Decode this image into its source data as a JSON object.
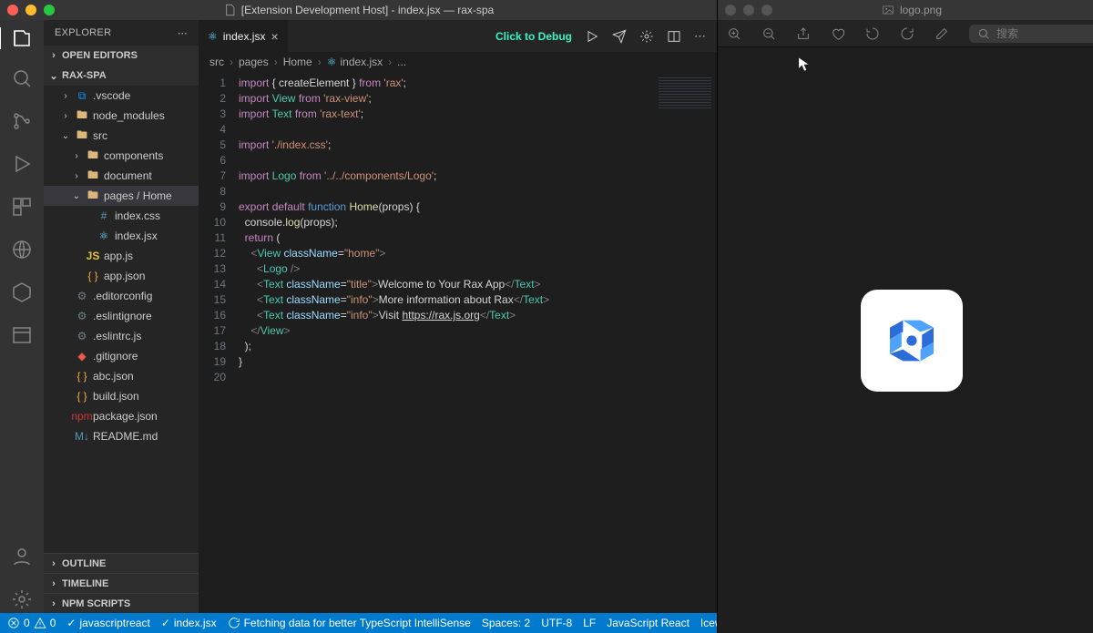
{
  "window": {
    "title": "[Extension Development Host] - index.jsx — rax-spa",
    "right_title": "logo.png"
  },
  "sidebar": {
    "header": "EXPLORER",
    "sections": {
      "open_editors": "OPEN EDITORS",
      "project": "RAX-SPA",
      "outline": "OUTLINE",
      "timeline": "TIMELINE",
      "npm_scripts": "NPM SCRIPTS"
    },
    "tree": [
      {
        "name": ".vscode",
        "type": "folder-vscode",
        "depth": 1,
        "closed": true
      },
      {
        "name": "node_modules",
        "type": "folder",
        "depth": 1,
        "closed": true
      },
      {
        "name": "src",
        "type": "folder",
        "depth": 1,
        "open": true
      },
      {
        "name": "components",
        "type": "folder",
        "depth": 2,
        "closed": true
      },
      {
        "name": "document",
        "type": "folder",
        "depth": 2,
        "closed": true
      },
      {
        "name": "pages / Home",
        "type": "folder",
        "depth": 2,
        "open": true,
        "selected": true
      },
      {
        "name": "index.css",
        "type": "css",
        "depth": 3
      },
      {
        "name": "index.jsx",
        "type": "react",
        "depth": 3
      },
      {
        "name": "app.js",
        "type": "js",
        "depth": 2
      },
      {
        "name": "app.json",
        "type": "json",
        "depth": 2
      },
      {
        "name": ".editorconfig",
        "type": "cfg",
        "depth": 1
      },
      {
        "name": ".eslintignore",
        "type": "cfg",
        "depth": 1
      },
      {
        "name": ".eslintrc.js",
        "type": "cfg",
        "depth": 1
      },
      {
        "name": ".gitignore",
        "type": "git",
        "depth": 1
      },
      {
        "name": "abc.json",
        "type": "json",
        "depth": 1
      },
      {
        "name": "build.json",
        "type": "json",
        "depth": 1
      },
      {
        "name": "package.json",
        "type": "npm",
        "depth": 1
      },
      {
        "name": "README.md",
        "type": "md",
        "depth": 1
      }
    ]
  },
  "tabs": {
    "active": "index.jsx",
    "debug_hint": "Click to Debug"
  },
  "breadcrumbs": [
    "src",
    "pages",
    "Home",
    "index.jsx",
    "..."
  ],
  "code": {
    "lines": [
      [
        {
          "t": "import",
          "c": "red"
        },
        {
          "t": " { createElement } ",
          "c": "white"
        },
        {
          "t": "from",
          "c": "red"
        },
        {
          "t": " 'rax'",
          "c": "string"
        },
        {
          "t": ";",
          "c": "white"
        }
      ],
      [
        {
          "t": "import",
          "c": "red"
        },
        {
          "t": " View ",
          "c": "type"
        },
        {
          "t": "from",
          "c": "red"
        },
        {
          "t": " 'rax-view'",
          "c": "string"
        },
        {
          "t": ";",
          "c": "white"
        }
      ],
      [
        {
          "t": "import",
          "c": "red"
        },
        {
          "t": " Text ",
          "c": "type"
        },
        {
          "t": "from",
          "c": "red"
        },
        {
          "t": " 'rax-text'",
          "c": "string"
        },
        {
          "t": ";",
          "c": "white"
        }
      ],
      [],
      [
        {
          "t": "import",
          "c": "red"
        },
        {
          "t": " './index.css'",
          "c": "string"
        },
        {
          "t": ";",
          "c": "white"
        }
      ],
      [],
      [
        {
          "t": "import",
          "c": "red"
        },
        {
          "t": " Logo ",
          "c": "type"
        },
        {
          "t": "from",
          "c": "red"
        },
        {
          "t": " '../../components/Logo'",
          "c": "string"
        },
        {
          "t": ";",
          "c": "white"
        }
      ],
      [],
      [
        {
          "t": "export",
          "c": "red"
        },
        {
          "t": " ",
          "c": "white"
        },
        {
          "t": "default",
          "c": "red"
        },
        {
          "t": " ",
          "c": "white"
        },
        {
          "t": "function",
          "c": "blue"
        },
        {
          "t": " ",
          "c": "white"
        },
        {
          "t": "Home",
          "c": "yellow"
        },
        {
          "t": "(props) {",
          "c": "white"
        }
      ],
      [
        {
          "t": "  console.",
          "c": "white"
        },
        {
          "t": "log",
          "c": "yellow"
        },
        {
          "t": "(props);",
          "c": "white"
        }
      ],
      [
        {
          "t": "  ",
          "c": "white"
        },
        {
          "t": "return",
          "c": "red"
        },
        {
          "t": " (",
          "c": "white"
        }
      ],
      [
        {
          "t": "    <",
          "c": "gray"
        },
        {
          "t": "View",
          "c": "type"
        },
        {
          "t": " ",
          "c": "white"
        },
        {
          "t": "className",
          "c": "attr"
        },
        {
          "t": "=",
          "c": "white"
        },
        {
          "t": "\"home\"",
          "c": "string"
        },
        {
          "t": ">",
          "c": "gray"
        }
      ],
      [
        {
          "t": "      <",
          "c": "gray"
        },
        {
          "t": "Logo",
          "c": "type"
        },
        {
          "t": " />",
          "c": "gray"
        }
      ],
      [
        {
          "t": "      <",
          "c": "gray"
        },
        {
          "t": "Text",
          "c": "type"
        },
        {
          "t": " ",
          "c": "white"
        },
        {
          "t": "className",
          "c": "attr"
        },
        {
          "t": "=",
          "c": "white"
        },
        {
          "t": "\"title\"",
          "c": "string"
        },
        {
          "t": ">",
          "c": "gray"
        },
        {
          "t": "Welcome to Your Rax App",
          "c": "white"
        },
        {
          "t": "</",
          "c": "gray"
        },
        {
          "t": "Text",
          "c": "type"
        },
        {
          "t": ">",
          "c": "gray"
        }
      ],
      [
        {
          "t": "      <",
          "c": "gray"
        },
        {
          "t": "Text",
          "c": "type"
        },
        {
          "t": " ",
          "c": "white"
        },
        {
          "t": "className",
          "c": "attr"
        },
        {
          "t": "=",
          "c": "white"
        },
        {
          "t": "\"info\"",
          "c": "string"
        },
        {
          "t": ">",
          "c": "gray"
        },
        {
          "t": "More information about Rax",
          "c": "white"
        },
        {
          "t": "</",
          "c": "gray"
        },
        {
          "t": "Text",
          "c": "type"
        },
        {
          "t": ">",
          "c": "gray"
        }
      ],
      [
        {
          "t": "      <",
          "c": "gray"
        },
        {
          "t": "Text",
          "c": "type"
        },
        {
          "t": " ",
          "c": "white"
        },
        {
          "t": "className",
          "c": "attr"
        },
        {
          "t": "=",
          "c": "white"
        },
        {
          "t": "\"info\"",
          "c": "string"
        },
        {
          "t": ">",
          "c": "gray"
        },
        {
          "t": "Visit ",
          "c": "white"
        },
        {
          "t": "https://rax.js.org",
          "c": "white",
          "u": true
        },
        {
          "t": "</",
          "c": "gray"
        },
        {
          "t": "Text",
          "c": "type"
        },
        {
          "t": ">",
          "c": "gray"
        }
      ],
      [
        {
          "t": "    </",
          "c": "gray"
        },
        {
          "t": "View",
          "c": "type"
        },
        {
          "t": ">",
          "c": "gray"
        }
      ],
      [
        {
          "t": "  );",
          "c": "white"
        }
      ],
      [
        {
          "t": "}",
          "c": "white"
        }
      ],
      []
    ]
  },
  "status": {
    "errors": "0",
    "warnings": "0",
    "lang_mode_check": "javascriptreact",
    "current_file": "index.jsx",
    "message": "Fetching data for better TypeScript IntelliSense",
    "spaces": "Spaces: 2",
    "encoding": "UTF-8",
    "eol": "LF",
    "lang": "JavaScript React",
    "ext": "Iceworks"
  },
  "right_toolbar": {
    "search_placeholder": "搜索"
  }
}
